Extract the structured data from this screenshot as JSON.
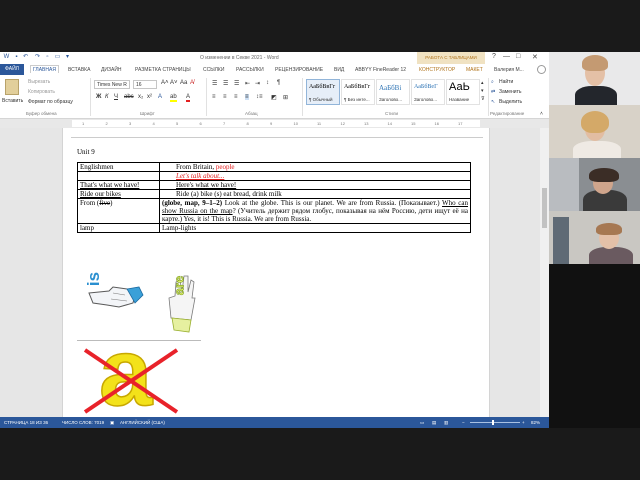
{
  "window": {
    "title": "О изменении в Секве 2021 - Word",
    "context_tab": "РАБОТА С ТАБЛИЦАМИ",
    "minimize": "—",
    "maximize": "□",
    "close": "✕",
    "help": "?"
  },
  "tabs": [
    {
      "label": "ФАЙЛ"
    },
    {
      "label": "ГЛАВНАЯ"
    },
    {
      "label": "ВСТАВКА"
    },
    {
      "label": "ДИЗАЙН"
    },
    {
      "label": "РАЗМЕТКА СТРАНИЦЫ"
    },
    {
      "label": "ССЫЛКИ"
    },
    {
      "label": "РАССЫЛКИ"
    },
    {
      "label": "РЕЦЕНЗИРОВАНИЕ"
    },
    {
      "label": "ВИД"
    },
    {
      "label": "ABBYY FineReader 12"
    },
    {
      "label": "КОНСТРУКТОР"
    },
    {
      "label": "МАКЕТ"
    }
  ],
  "user": "Валерия М...",
  "ribbon": {
    "clipboard": {
      "paste": "Вставить",
      "cut": "Вырезать",
      "copy": "Копировать",
      "format_painter": "Формат по образцу",
      "group": "Буфер обмена"
    },
    "font": {
      "name": "Times New R",
      "size": "16",
      "bold": "Ж",
      "italic": "К",
      "underline": "Ч",
      "group": "Шрифт"
    },
    "paragraph": {
      "group": "Абзац"
    },
    "styles": {
      "items": [
        {
          "preview": "АаБбВвГг",
          "name": "¶ Обычный"
        },
        {
          "preview": "АаБбВвГг",
          "name": "¶ Без инте..."
        },
        {
          "preview": "АаБбВі",
          "name": "Заголово..."
        },
        {
          "preview": "АаБбВеГ",
          "name": "Заголово..."
        },
        {
          "preview": "АаЬ",
          "name": "Название"
        }
      ],
      "group": "Стили"
    },
    "editing": {
      "find": "Найти",
      "replace": "Заменить",
      "select": "Выделить",
      "group": "Редактирование"
    }
  },
  "ruler": {
    "marks": [
      "1",
      "2",
      "3",
      "4",
      "5",
      "6",
      "7",
      "8",
      "9",
      "10",
      "11",
      "12",
      "13",
      "14",
      "15",
      "16",
      "17"
    ]
  },
  "document": {
    "heading": "Unit 9",
    "rows": [
      {
        "left": "Englishmen",
        "right_a": "From Britain, ",
        "right_b": "people",
        "right_c": "Let's talk about..."
      },
      {
        "left": "That's what we have!",
        "right": "Here's what we have!"
      },
      {
        "left": "Ride our bikes",
        "right": "Ride (a) bike (s) eat bread, drink milk"
      },
      {
        "left_a": "From (",
        "left_b": "five",
        "left_c": ")",
        "right_a": "(globe, map, 9–1–2)",
        "right_b": " Look at the globe. This is our planet. We are from Russia. (Показывает.) ",
        "right_c": "Who can show Russia on the map",
        "right_d": "? (Учитель держит рядом глобус, показывая на нём Россию, дети ищут её на карте.) Yes, it is! This is Russia. We are from Russia."
      },
      {
        "left": "lamp",
        "right": "Lamp-lights"
      }
    ],
    "card1_text": "is",
    "card2_text": "are",
    "card3_letter": "a"
  },
  "status": {
    "page": "СТРАНИЦА 18 ИЗ 36",
    "words": "ЧИСЛО СЛОВ: 7019",
    "lang": "АНГЛИЙСКИЙ (США)",
    "zoom": "82%"
  },
  "colors": {
    "word_blue": "#2b579a",
    "red_text": "#e32020",
    "cross_red": "#e8222a",
    "letter_yellow": "#f3e21a"
  }
}
